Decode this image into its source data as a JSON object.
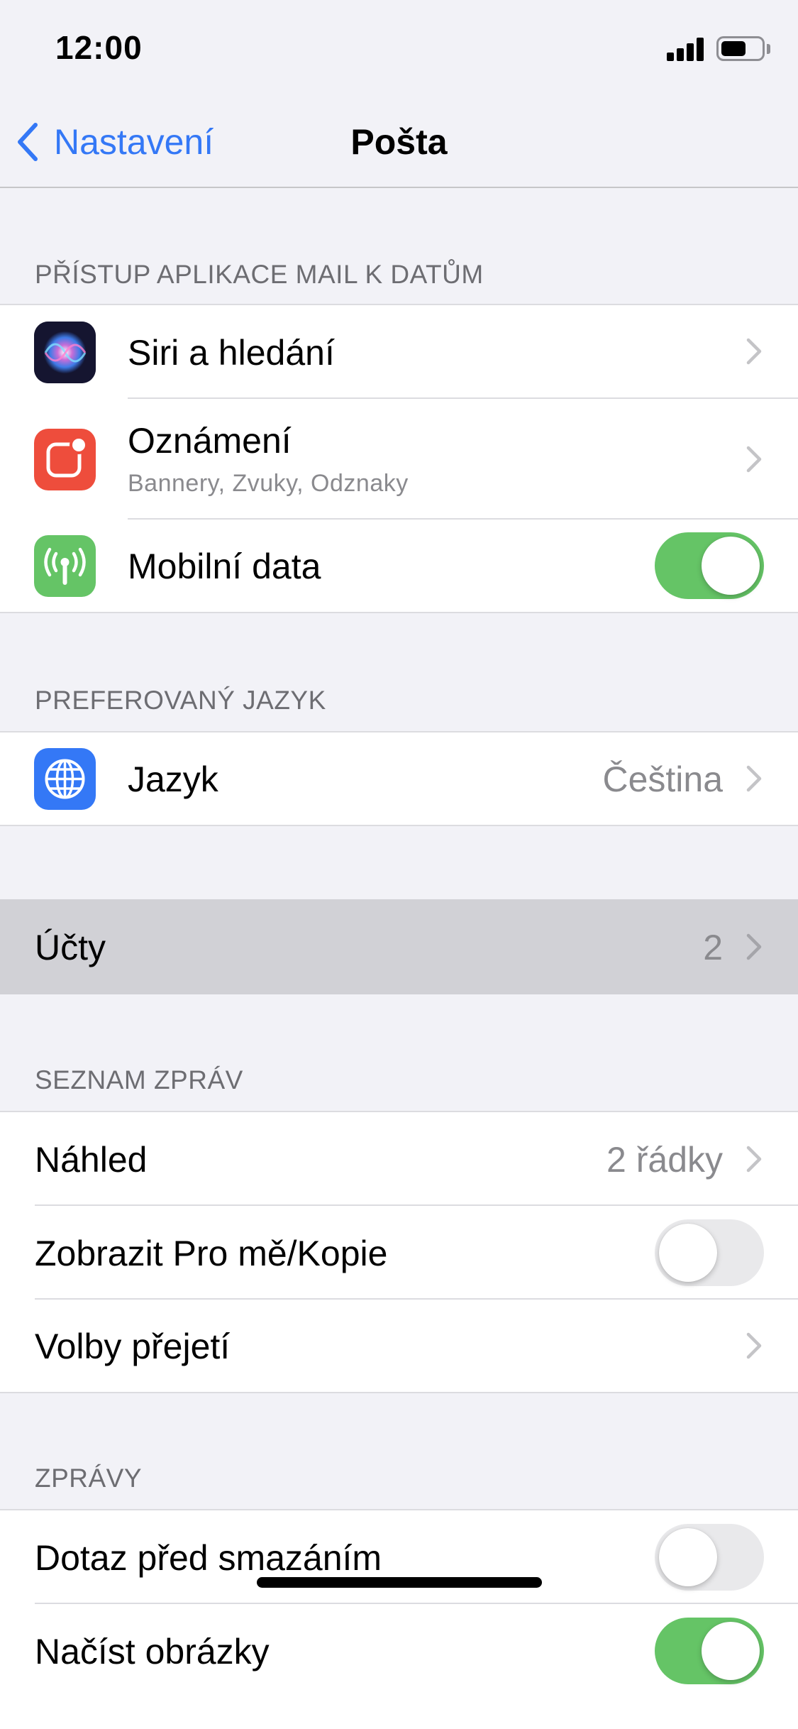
{
  "status_bar": {
    "time": "12:00",
    "battery_level": 0.6
  },
  "navbar": {
    "back_label": "Nastavení",
    "title": "Pošta"
  },
  "sections": {
    "mail_access": {
      "header": "PŘÍSTUP APLIKACE MAIL K DATŮM",
      "siri": {
        "label": "Siri a hledání"
      },
      "notifications": {
        "label": "Oznámení",
        "subtitle": "Bannery, Zvuky, Odznaky"
      },
      "mobile_data": {
        "label": "Mobilní data",
        "on": true
      }
    },
    "language": {
      "header": "PREFEROVANÝ JAZYK",
      "language": {
        "label": "Jazyk",
        "value": "Čeština"
      }
    },
    "accounts": {
      "label": "Účty",
      "value": "2"
    },
    "message_list": {
      "header": "SEZNAM ZPRÁV",
      "preview": {
        "label": "Náhled",
        "value": "2 řádky"
      },
      "show_to_cc": {
        "label": "Zobrazit Pro mě/Kopie",
        "on": false
      },
      "swipe_options": {
        "label": "Volby přejetí"
      }
    },
    "messages": {
      "header": "ZPRÁVY",
      "ask_before_deleting": {
        "label": "Dotaz před smazáním",
        "on": false
      },
      "load_images": {
        "label": "Načíst obrázky",
        "on": true
      }
    }
  },
  "colors": {
    "accent": "#3478f6",
    "toggle_on": "#65c466",
    "toggle_off": "#e9e9eb",
    "notifications_icon": "#ee4d3c",
    "mobile_data_icon": "#65c466",
    "language_icon": "#3478f6",
    "highlight_row": "#d1d1d6"
  },
  "icons": {
    "siri": "siri-icon",
    "notifications": "notifications-icon",
    "mobile_data": "antenna-icon",
    "language": "globe-icon"
  }
}
